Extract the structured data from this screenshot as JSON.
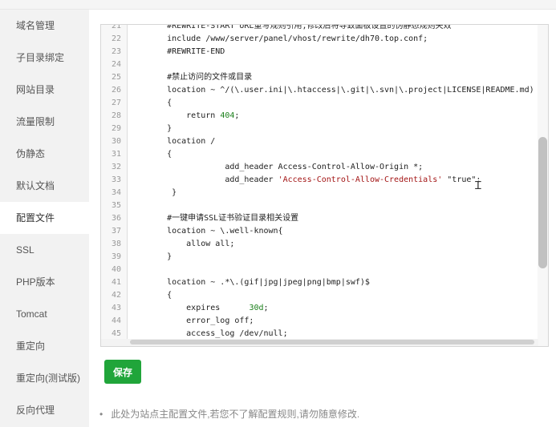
{
  "sidebar": {
    "items": [
      {
        "label": "域名管理"
      },
      {
        "label": "子目录绑定"
      },
      {
        "label": "网站目录"
      },
      {
        "label": "流量限制"
      },
      {
        "label": "伪静态"
      },
      {
        "label": "默认文档"
      },
      {
        "label": "配置文件",
        "active": true
      },
      {
        "label": "SSL"
      },
      {
        "label": "PHP版本"
      },
      {
        "label": "Tomcat"
      },
      {
        "label": "重定向"
      },
      {
        "label": "重定向(测试版)"
      },
      {
        "label": "反向代理"
      }
    ]
  },
  "editor": {
    "lines": [
      {
        "n": "21",
        "segments": [
          {
            "t": "    #REWRITE-START URL重写规则引用,修改后将导致面板设置的伪静态规则失效"
          }
        ]
      },
      {
        "n": "22",
        "segments": [
          {
            "t": "    include /www/server/panel/vhost/rewrite/dh70.top.conf;"
          }
        ]
      },
      {
        "n": "23",
        "segments": [
          {
            "t": "    #REWRITE-END"
          }
        ]
      },
      {
        "n": "24",
        "segments": [
          {
            "t": ""
          }
        ]
      },
      {
        "n": "25",
        "segments": [
          {
            "t": "    #禁止访问的文件或目录"
          }
        ]
      },
      {
        "n": "26",
        "segments": [
          {
            "t": "    location ~ ^/(\\.user.ini|\\.htaccess|\\.git|\\.svn|\\.project|LICENSE|README.md)"
          }
        ]
      },
      {
        "n": "27",
        "segments": [
          {
            "t": "    {"
          }
        ]
      },
      {
        "n": "28",
        "segments": [
          {
            "t": "        return "
          },
          {
            "t": "404",
            "c": "num"
          },
          {
            "t": ";"
          }
        ]
      },
      {
        "n": "29",
        "segments": [
          {
            "t": "    }"
          }
        ]
      },
      {
        "n": "30",
        "segments": [
          {
            "t": "    location /"
          }
        ]
      },
      {
        "n": "31",
        "segments": [
          {
            "t": "    {"
          }
        ]
      },
      {
        "n": "32",
        "segments": [
          {
            "t": "                add_header Access-Control-Allow-Origin *;"
          }
        ]
      },
      {
        "n": "33",
        "segments": [
          {
            "t": "                add_header "
          },
          {
            "t": "'Access-Control-Allow-Credentials'",
            "c": "str"
          },
          {
            "t": " \"true\";"
          }
        ]
      },
      {
        "n": "34",
        "segments": [
          {
            "t": "     }"
          }
        ]
      },
      {
        "n": "35",
        "segments": [
          {
            "t": ""
          }
        ]
      },
      {
        "n": "36",
        "segments": [
          {
            "t": "    #一键申请SSL证书验证目录相关设置"
          }
        ]
      },
      {
        "n": "37",
        "segments": [
          {
            "t": "    location ~ \\.well-known{"
          }
        ]
      },
      {
        "n": "38",
        "segments": [
          {
            "t": "        allow all;"
          }
        ]
      },
      {
        "n": "39",
        "segments": [
          {
            "t": "    }"
          }
        ]
      },
      {
        "n": "40",
        "segments": [
          {
            "t": ""
          }
        ]
      },
      {
        "n": "41",
        "segments": [
          {
            "t": "    location ~ .*\\.(gif|jpg|jpeg|png|bmp|swf)$"
          }
        ]
      },
      {
        "n": "42",
        "segments": [
          {
            "t": "    {"
          }
        ]
      },
      {
        "n": "43",
        "segments": [
          {
            "t": "        expires      "
          },
          {
            "t": "30d",
            "c": "num"
          },
          {
            "t": ";"
          }
        ]
      },
      {
        "n": "44",
        "segments": [
          {
            "t": "        error_log off;"
          }
        ]
      },
      {
        "n": "45",
        "segments": [
          {
            "t": "        access_log /dev/null;"
          }
        ]
      }
    ]
  },
  "save_label": "保存",
  "note": "此处为站点主配置文件,若您不了解配置规则,请勿随意修改.",
  "note_bullet": "•"
}
